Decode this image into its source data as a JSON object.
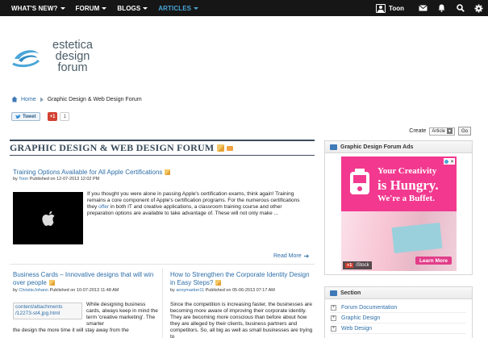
{
  "topbar": {
    "nav": [
      {
        "label": "WHAT'S NEW?"
      },
      {
        "label": "FORUM"
      },
      {
        "label": "BLOGS"
      },
      {
        "label": "ARTICLES"
      }
    ],
    "user_name": "Toon",
    "icons": [
      "user-icon",
      "mail-icon",
      "bell-icon",
      "search-icon",
      "gear-icon"
    ]
  },
  "logo": {
    "line1": "estetica",
    "line2": "design",
    "line3": "forum"
  },
  "breadcrumb": {
    "home": "Home",
    "current": "Graphic Design & Web Design Forum"
  },
  "share": {
    "tweet": "Tweet",
    "gplus": "+1",
    "gplus_count": "1"
  },
  "create": {
    "label": "Create",
    "selected": "Article",
    "go": "Go"
  },
  "forum": {
    "title": "GRAPHIC DESIGN & WEB DESIGN FORUM"
  },
  "articles": [
    {
      "title": "Training Options Available for All Apple Certifications",
      "meta_by": "by",
      "author": "Toon",
      "meta_published": "Published on 12-07-2013 12:02 PM",
      "body_before": "If you thought you were alone in passing Apple's certification exams, think again! Training remains a core component of Apple's certification programs. For the numerous certifications they ",
      "body_link": "offer",
      "body_after": " in both IT and creative applications, a classroom training course and other preparation options are available to take advantage of. These will not only make ...",
      "read_more": "Read More"
    },
    {
      "title": "Business Cards – Innovative designs that will win over people",
      "meta_by": "by",
      "author": "ChristieJohann",
      "meta_published": "Published on 10-07-2013 11:48 AM",
      "attachment": "content/attachments /12273-st4.jpg.html",
      "body": "While designing business cards, always keep in mind the term 'creative marketing'. The smarter",
      "body_cont": "the design the more time it will stay away from the"
    },
    {
      "title": "How to Strengthen the Corporate Identity Design in Easy Steps?",
      "meta_by": "by",
      "author": "annymarker11",
      "meta_published": "Published on 05-06-2013 07:17 AM",
      "body": "Since the competition is increasing faster, the businesses are becoming more aware of improving their corporate identity. They are becoming more conscious than before about how they are alleged by their clients, business partners and competitors. So, all big as well as small businesses are trying to"
    }
  ],
  "sidebar": {
    "ads_title": "Graphic Design Forum Ads",
    "ad": {
      "line1": "Your Creativity",
      "line2": "is Hungry.",
      "line3": "We're a Buffet.",
      "cta": "Learn More",
      "brand": "iStock",
      "gplus": "+1",
      "close": "✕"
    },
    "section_title": "Section",
    "sections": [
      {
        "label": "Forum Documentation"
      },
      {
        "label": "Graphic Design"
      },
      {
        "label": "Web Design"
      }
    ]
  },
  "colors": {
    "topbar": "#161616",
    "link": "#2d6ea8",
    "active_nav": "#4aa6d8",
    "heading": "#3a4c5c",
    "ad_pink": "#f2398f"
  }
}
